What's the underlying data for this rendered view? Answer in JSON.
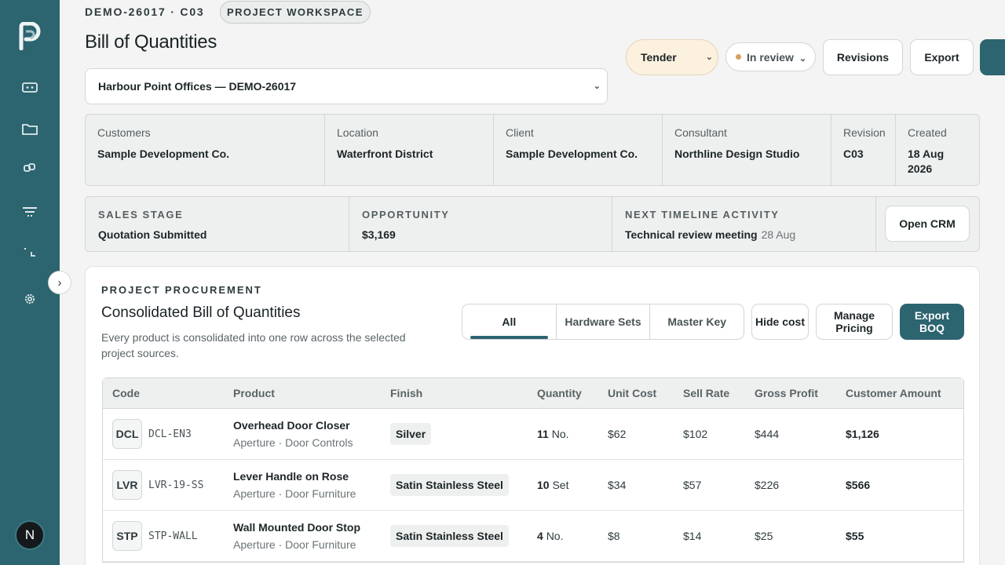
{
  "nav": {
    "icons": [
      "logo-icon",
      "dashboard-icon",
      "folder-icon",
      "link-icon",
      "filter-icon",
      "crop-icon",
      "settings-icon"
    ],
    "avatar_initial": "N",
    "collapse_glyph": "›"
  },
  "header": {
    "eyebrow": "DEMO-26017 · C03",
    "chip": "PROJECT WORKSPACE",
    "title": "Bill of Quantities",
    "project_select": "Harbour Point Offices — DEMO-26017",
    "type_select": "Tender",
    "status": "In review",
    "revisions_label": "Revisions",
    "export_label": "Export"
  },
  "meta": [
    {
      "label": "Customers",
      "value": "Sample Development Co."
    },
    {
      "label": "Location",
      "value": "Waterfront District"
    },
    {
      "label": "Client",
      "value": "Sample Development Co."
    },
    {
      "label": "Consultant",
      "value": "Northline Design Studio"
    },
    {
      "label": "Revision",
      "value": "C03"
    },
    {
      "label": "Created",
      "value": "18 Aug 2026"
    }
  ],
  "crm": {
    "sales_stage_label": "SALES STAGE",
    "sales_stage": "Quotation Submitted",
    "opportunity_label": "OPPORTUNITY",
    "opportunity": "$3,169",
    "next_activity_label": "NEXT TIMELINE ACTIVITY",
    "next_activity": "Technical review meeting",
    "next_activity_date": "28 Aug",
    "open_crm_label": "Open CRM"
  },
  "procurement": {
    "eyebrow": "PROJECT PROCUREMENT",
    "title": "Consolidated Bill of Quantities",
    "description": "Every product is consolidated into one row across the selected project sources.",
    "tabs": [
      "All",
      "Hardware Sets",
      "Master Key"
    ],
    "hide_cost_label": "Hide cost",
    "manage_pricing_label": "Manage Pricing",
    "export_boq_label": "Export BOQ",
    "columns": [
      "Code",
      "Product",
      "Finish",
      "Quantity",
      "Unit Cost",
      "Sell Rate",
      "Gross Profit",
      "Customer Amount"
    ],
    "rows": [
      {
        "badge": "DCL",
        "sku": "DCL-EN3",
        "product": "Overhead Door Closer",
        "category": "Aperture · Door Controls",
        "finish": "Silver",
        "qty": "11",
        "unit": "No.",
        "unit_cost": "$62",
        "sell_rate": "$102",
        "gross_profit": "$444",
        "amount": "$1,126"
      },
      {
        "badge": "LVR",
        "sku": "LVR-19-SS",
        "product": "Lever Handle on Rose",
        "category": "Aperture · Door Furniture",
        "finish": "Satin Stainless Steel",
        "qty": "10",
        "unit": "Set",
        "unit_cost": "$34",
        "sell_rate": "$57",
        "gross_profit": "$226",
        "amount": "$566"
      },
      {
        "badge": "STP",
        "sku": "STP-WALL",
        "product": "Wall Mounted Door Stop",
        "category": "Aperture · Door Furniture",
        "finish": "Satin Stainless Steel",
        "qty": "4",
        "unit": "No.",
        "unit_cost": "$8",
        "sell_rate": "$14",
        "gross_profit": "$25",
        "amount": "$55"
      }
    ]
  }
}
